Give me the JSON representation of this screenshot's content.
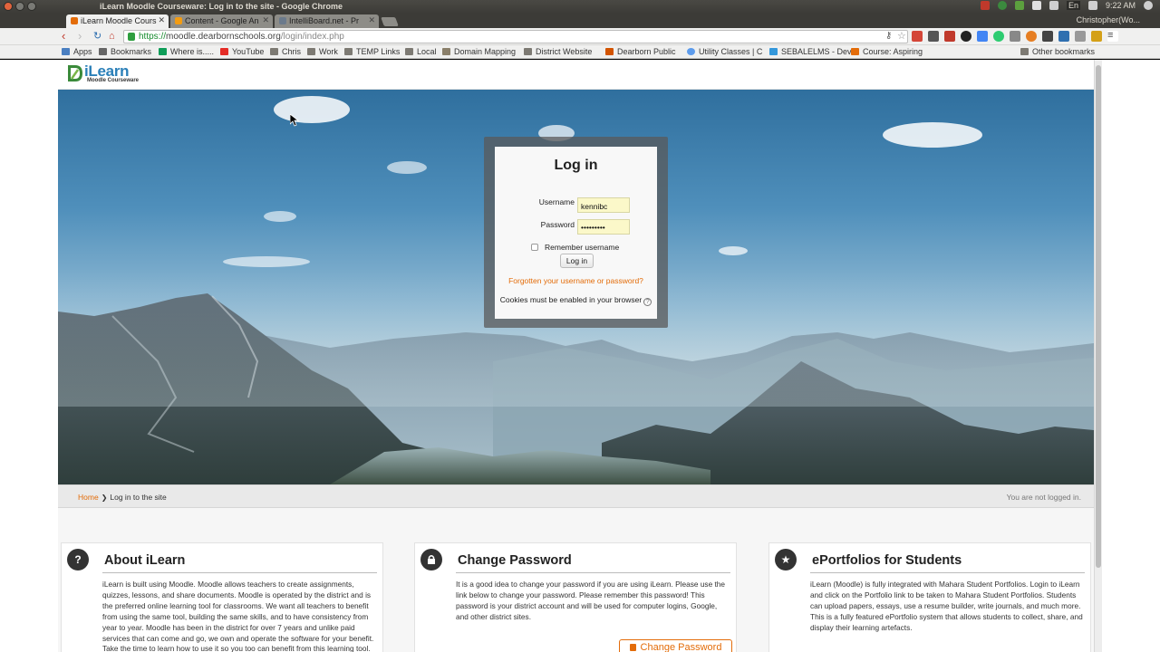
{
  "os": {
    "window_title": "iLearn Moodle Courseware: Log in to the site - Google Chrome",
    "clock": "9:22 AM",
    "lang": "En",
    "user": "Christopher(Wo..."
  },
  "tabs": [
    {
      "label": "iLearn Moodle Cours",
      "active": true
    },
    {
      "label": "Content - Google An",
      "active": false
    },
    {
      "label": "IntelliBoard.net - Pr",
      "active": false
    }
  ],
  "address": {
    "scheme": "https://",
    "host": "moodle.dearbornschools.org",
    "path": "/login/index.php"
  },
  "bookmarks": [
    {
      "label": "Apps",
      "icon": "apps-grid-icon"
    },
    {
      "label": "Bookmarks",
      "icon": "bookmarks-icon"
    },
    {
      "label": "Where is.....",
      "icon": "sheet-icon"
    },
    {
      "label": "YouTube",
      "icon": "youtube-icon"
    },
    {
      "label": "Chris",
      "icon": "folder-icon"
    },
    {
      "label": "Work",
      "icon": "folder-icon"
    },
    {
      "label": "TEMP Links",
      "icon": "folder-icon"
    },
    {
      "label": "Local",
      "icon": "folder-icon"
    },
    {
      "label": "Domain Mapping",
      "icon": "mm-icon"
    },
    {
      "label": "District Website",
      "icon": "folder-icon"
    },
    {
      "label": "Dearborn Public",
      "icon": "dp-icon"
    },
    {
      "label": "Utility Classes | C",
      "icon": "globe-icon"
    },
    {
      "label": "SEBALELMS - Dev",
      "icon": "s-icon"
    },
    {
      "label": "Course: Aspiring",
      "icon": "moodle-icon"
    },
    {
      "label": "Other bookmarks",
      "icon": "folder-icon"
    }
  ],
  "site": {
    "logo_text": "iLearn",
    "logo_sub": "Moodle Courseware"
  },
  "login": {
    "title": "Log in",
    "username_label": "Username",
    "username_value": "kennibc",
    "password_label": "Password",
    "password_value": "•••••••••",
    "remember_label": "Remember username",
    "remember_checked": false,
    "button": "Log in",
    "forgot_link": "Forgotten your username or password?",
    "cookies_note": "Cookies must be enabled in your browser"
  },
  "breadcrumb": {
    "home": "Home",
    "separator": "❯",
    "current": "Log in to the site",
    "status": "You are not logged in."
  },
  "cards": [
    {
      "icon": "question-icon",
      "glyph": "?",
      "title": "About iLearn",
      "text": "iLearn is built using Moodle.  Moodle allows teachers to create assignments, quizzes, lessons, and share documents.  Moodle is operated by the district and is the preferred online learning tool for classrooms.  We want all teachers to benefit from using the same tool, building the same skills, and to have consistency from year to year.  Moodle has been in the district for over 7 years and unlike paid services that can come and go, we own and operate the software for your benefit.  Take the time to learn how to use it so you too can benefit from this learning tool."
    },
    {
      "icon": "lock-icon",
      "glyph": "🔒",
      "title": "Change Password",
      "text": "It is a good idea to change your password if you are using iLearn.  Please use the link below to change your password.  Please remember this password!  This password is your district account and will be used for computer logins, Google, and other district sites.",
      "button": "Change Password"
    },
    {
      "icon": "star-icon",
      "glyph": "★",
      "title": "ePortfolios for Students",
      "text": "iLearn (Moodle) is fully integrated with Mahara Student Portfolios.  Login to iLearn and click on the Portfolio link to be taken to Mahara Student Portfolios.  Students can upload papers, essays, use a resume builder, write journals, and much more.  This is a fully featured ePortfolio system that allows students to collect, share, and display their learning artefacts."
    }
  ],
  "colors": {
    "accent": "#e36c09",
    "brand": "#2a7fb8",
    "field_bg": "#fbf8c9"
  }
}
